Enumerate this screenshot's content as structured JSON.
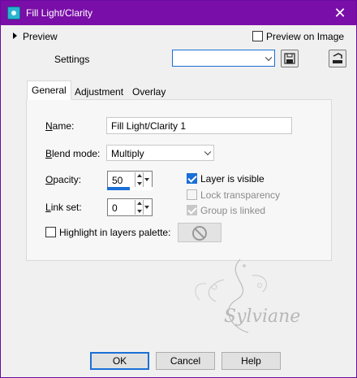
{
  "window": {
    "title": "Fill Light/Clarity"
  },
  "preview": {
    "toggle_label": "Preview",
    "preview_on_image_label": "Preview on Image",
    "preview_on_image_checked": false
  },
  "settings": {
    "label": "Settings",
    "value": ""
  },
  "tabs": [
    {
      "label": "General",
      "active": true
    },
    {
      "label": "Adjustment",
      "active": false
    },
    {
      "label": "Overlay",
      "active": false
    }
  ],
  "general": {
    "name_label": "Name:",
    "name_value": "Fill Light/Clarity 1",
    "blend_mode_label": "Blend mode:",
    "blend_mode_value": "Multiply",
    "opacity_label": "Opacity:",
    "opacity_value": "50",
    "opacity_fraction": 0.5,
    "link_set_label": "Link set:",
    "link_set_value": "0",
    "highlight_label": "Highlight in layers palette:",
    "highlight_checked": false,
    "layer_visible_label": "Layer is visible",
    "layer_visible_checked": true,
    "lock_transparency_label": "Lock transparency",
    "lock_transparency_checked": false,
    "group_linked_label": "Group is linked",
    "group_linked_checked": true
  },
  "watermark": {
    "text": "Sylviane"
  },
  "buttons": {
    "ok": "OK",
    "cancel": "Cancel",
    "help": "Help"
  },
  "colors": {
    "titlebar": "#7a0ea8",
    "accent": "#1a6fd6"
  }
}
